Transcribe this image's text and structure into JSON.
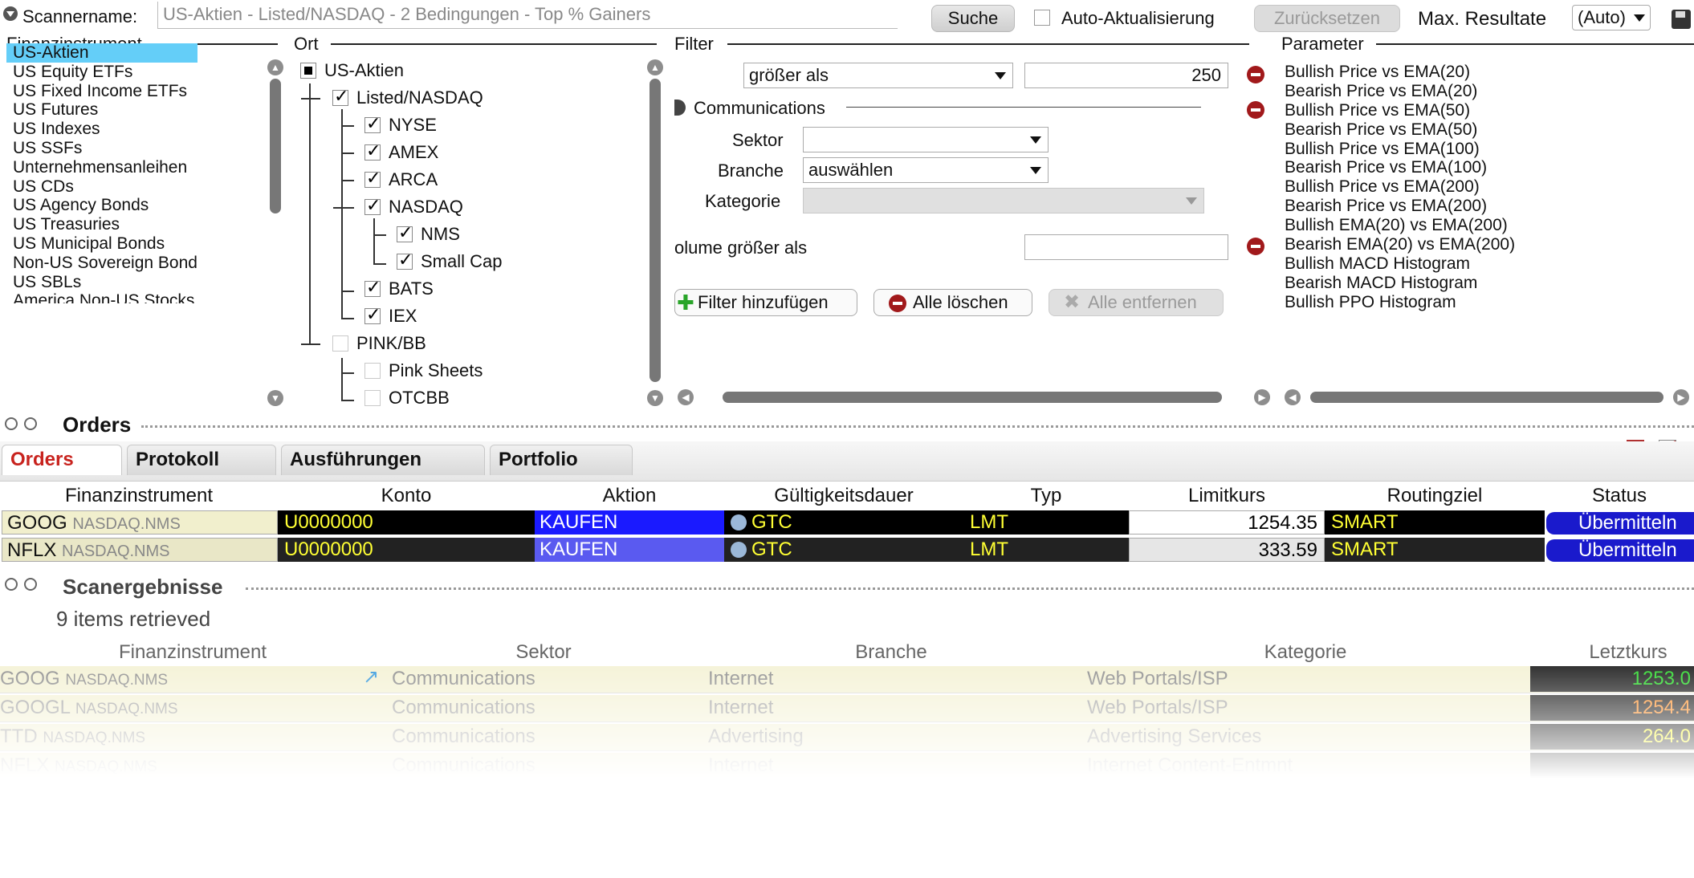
{
  "scanner": {
    "name_label": "Scannername:",
    "name_value": "US-Aktien - Listed/NASDAQ - 2 Bedingungen - Top % Gainers",
    "search_label": "Suche",
    "auto_update_label": "Auto-Aktualisierung",
    "reset_label": "Zurücksetzen",
    "max_results_label": "Max. Resultate",
    "max_results_value": "(Auto)"
  },
  "sections": {
    "instrument": "Finanzinstrument",
    "location": "Ort",
    "filter": "Filter",
    "parameter": "Parameter"
  },
  "instruments": [
    "US-Aktien",
    "US Equity ETFs",
    "US Fixed Income ETFs",
    "US Futures",
    "US Indexes",
    "US SSFs",
    "Unternehmensanleihen",
    "US CDs",
    "US Agency Bonds",
    "US Treasuries",
    "US Municipal Bonds",
    "Non-US Sovereign Bonds",
    "US SBLs",
    "America Non-US Stocks"
  ],
  "locations": {
    "root": "US-Aktien",
    "listed": "Listed/NASDAQ",
    "nyse": "NYSE",
    "amex": "AMEX",
    "arca": "ARCA",
    "nasdaq": "NASDAQ",
    "nms": "NMS",
    "smallcap": "Small Cap",
    "bats": "BATS",
    "iex": "IEX",
    "pink": "PINK/BB",
    "pinksheets": "Pink Sheets",
    "otcbb": "OTCBB"
  },
  "filter": {
    "price_op": "größer als",
    "price_value": "250",
    "group": "Communications",
    "sector_label": "Sektor",
    "sector_value": "",
    "industry_label": "Branche",
    "industry_value": "auswählen",
    "category_label": "Kategorie",
    "category_value": "",
    "volume_label": "olume größer als",
    "volume_value": "",
    "add_label": "Filter hinzufügen",
    "clear_label": "Alle löschen",
    "remove_label": "Alle entfernen"
  },
  "parameters": [
    "Bullish Price vs EMA(20)",
    "Bearish Price vs EMA(20)",
    "Bullish Price vs EMA(50)",
    "Bearish Price vs EMA(50)",
    "Bullish Price vs EMA(100)",
    "Bearish Price vs EMA(100)",
    "Bullish Price vs EMA(200)",
    "Bearish Price vs EMA(200)",
    "Bullish EMA(20) vs EMA(200)",
    "Bearish EMA(20) vs EMA(200)",
    "Bullish MACD Histogram",
    "Bearish MACD Histogram",
    "Bullish PPO Histogram"
  ],
  "orders": {
    "title": "Orders",
    "tabs": [
      "Orders",
      "Protokoll",
      "Ausführungen",
      "Portfolio"
    ],
    "columns": [
      "Finanzinstrument",
      "Konto",
      "Aktion",
      "Gültigkeitsdauer",
      "Typ",
      "Limitkurs",
      "Routingziel",
      "Status"
    ],
    "rows": [
      {
        "symbol": "GOOG",
        "exchange": "NASDAQ.NMS",
        "account": "U0000000",
        "action": "KAUFEN",
        "tif": "GTC",
        "type": "LMT",
        "limit": "1254.35",
        "route": "SMART",
        "status": "Übermitteln"
      },
      {
        "symbol": "NFLX",
        "exchange": "NASDAQ.NMS",
        "account": "U0000000",
        "action": "KAUFEN",
        "tif": "GTC",
        "type": "LMT",
        "limit": "333.59",
        "route": "SMART",
        "status": "Übermitteln"
      }
    ]
  },
  "results": {
    "title": "Scanergebnisse",
    "count_text": "9 items retrieved",
    "columns": [
      "Finanzinstrument",
      "Sektor",
      "Branche",
      "Kategorie",
      "Letztkurs"
    ],
    "rows": [
      {
        "symbol": "GOOG",
        "exchange": "NASDAQ.NMS",
        "sector": "Communications",
        "industry": "Internet",
        "category": "Web Portals/ISP",
        "last": "1253.0"
      },
      {
        "symbol": "GOOGL",
        "exchange": "NASDAQ.NMS",
        "sector": "Communications",
        "industry": "Internet",
        "category": "Web Portals/ISP",
        "last": "1254.4"
      },
      {
        "symbol": "TTD",
        "exchange": "NASDAQ.NMS",
        "sector": "Communications",
        "industry": "Advertising",
        "category": "Advertising Services",
        "last": "264.0"
      },
      {
        "symbol": "NFLX",
        "exchange": "NASDAQ.NMS",
        "sector": "Communications",
        "industry": "Internet",
        "category": "Internet Content-Entmnt",
        "last": ""
      }
    ]
  },
  "colors": {
    "selection": "#64cef8",
    "buy": "#1a1aff",
    "tif": "#ffff33",
    "status": "#1a1acc",
    "tab_active": "#c8231e"
  }
}
